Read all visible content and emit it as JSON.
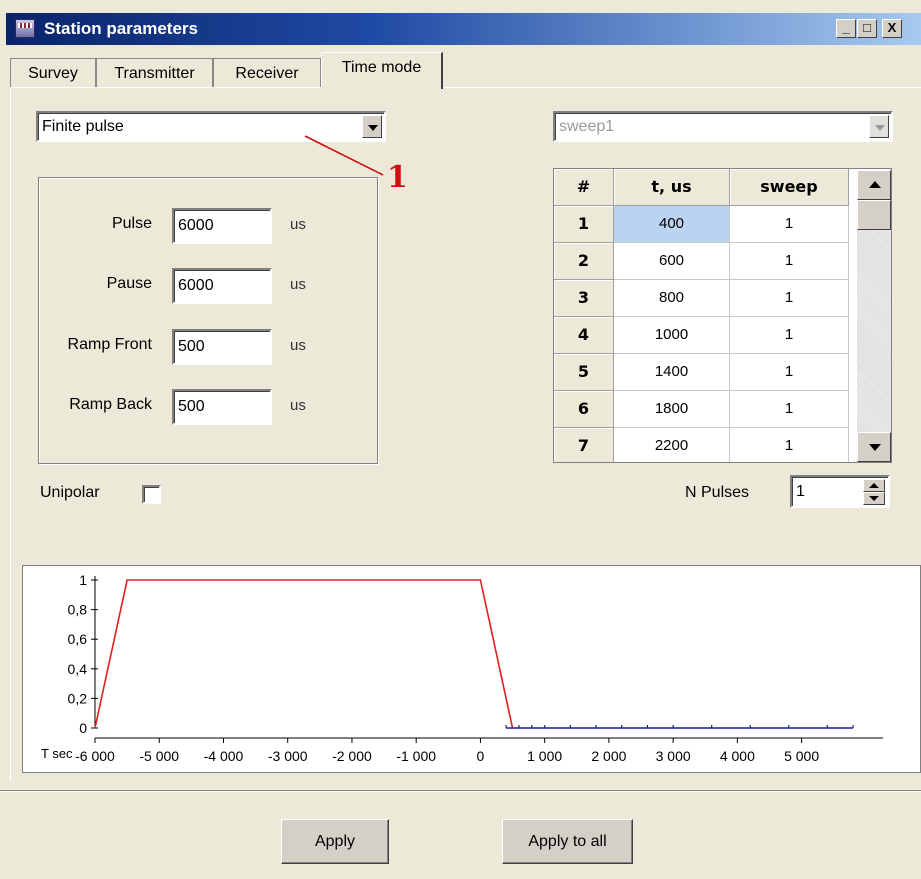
{
  "window": {
    "title": "Station parameters",
    "buttons": {
      "minimize": "_",
      "maximize": "□",
      "close": "X"
    }
  },
  "tabs": [
    {
      "label": "Survey",
      "active": false
    },
    {
      "label": "Transmitter",
      "active": false
    },
    {
      "label": "Receiver",
      "active": false
    },
    {
      "label": "Time mode",
      "active": true
    }
  ],
  "mode_select": {
    "value": "Finite pulse"
  },
  "annotation": {
    "label": "1",
    "color": "#d01010"
  },
  "pulse_params": {
    "pulse": {
      "label": "Pulse",
      "value": "6000",
      "unit": "us"
    },
    "pause": {
      "label": "Pause",
      "value": "6000",
      "unit": "us"
    },
    "ramp_front": {
      "label": "Ramp Front",
      "value": "500",
      "unit": "us"
    },
    "ramp_back": {
      "label": "Ramp Back",
      "value": "500",
      "unit": "us"
    }
  },
  "unipolar": {
    "label": "Unipolar",
    "checked": false
  },
  "sweep_select": {
    "value": "sweep1",
    "disabled": true
  },
  "sweep_table": {
    "columns": [
      "#",
      "t, us",
      "sweep"
    ],
    "rows": [
      [
        "1",
        "400",
        "1"
      ],
      [
        "2",
        "600",
        "1"
      ],
      [
        "3",
        "800",
        "1"
      ],
      [
        "4",
        "1000",
        "1"
      ],
      [
        "5",
        "1400",
        "1"
      ],
      [
        "6",
        "1800",
        "1"
      ],
      [
        "7",
        "2200",
        "1"
      ]
    ],
    "selected_row": 0
  },
  "n_pulses": {
    "label": "N Pulses",
    "value": "1"
  },
  "chart_data": {
    "type": "line",
    "xlabel": "T sec",
    "ylabel": "",
    "xlim": [
      -6000,
      5800
    ],
    "ylim": [
      0,
      1
    ],
    "x_ticks": [
      "-6 000",
      "-5 000",
      "-4 000",
      "-3 000",
      "-2 000",
      "-1 000",
      "0",
      "1 000",
      "2 000",
      "3 000",
      "4 000",
      "5 000"
    ],
    "y_ticks": [
      "0",
      "0,2",
      "0,4",
      "0,6",
      "0,8",
      "1"
    ],
    "series": [
      {
        "color": "#e02020",
        "x": [
          -6000,
          -5500,
          0,
          500
        ],
        "y": [
          0,
          1,
          1,
          0
        ]
      },
      {
        "color": "#1a1aa0",
        "x": [
          400,
          600,
          800,
          1000,
          1400,
          1800,
          2200,
          2600,
          3000,
          3600,
          4200,
          4800,
          5400,
          5800
        ],
        "y": [
          0,
          0,
          0,
          0,
          0,
          0,
          0,
          0,
          0,
          0,
          0,
          0,
          0,
          0
        ],
        "markers": true
      }
    ],
    "grid": false
  },
  "footer": {
    "apply_label": "Apply",
    "apply_all_label": "Apply to all"
  }
}
